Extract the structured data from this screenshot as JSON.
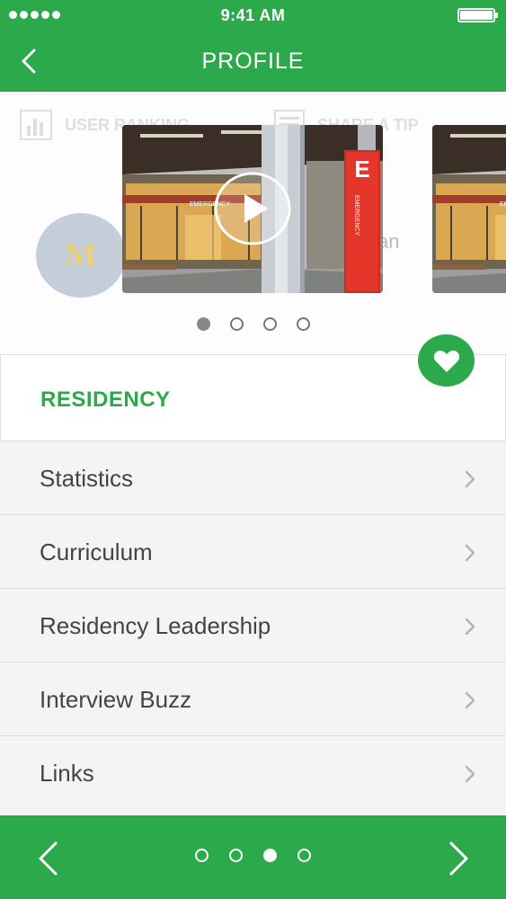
{
  "status_bar": {
    "time": "9:41 AM"
  },
  "nav": {
    "title": "PROFILE",
    "back_icon": "chevron-left-icon"
  },
  "header": {
    "faded_tabs": [
      {
        "label": "USER RANKING",
        "icon": "bar-chart-icon"
      },
      {
        "label": "SHARE A TIP",
        "icon": "document-icon"
      }
    ],
    "logo_letter": "M",
    "ghost_text": "an",
    "carousel": {
      "page_count": 4,
      "active_page": 1
    }
  },
  "section": {
    "title": "RESIDENCY",
    "favorite_icon": "heart-icon"
  },
  "menu": [
    {
      "label": "Statistics"
    },
    {
      "label": "Curriculum"
    },
    {
      "label": "Residency Leadership"
    },
    {
      "label": "Interview Buzz"
    },
    {
      "label": "Links"
    }
  ],
  "bottom_bar": {
    "page_count": 4,
    "active_page": 3
  },
  "colors": {
    "brand_green": "#2ca94b",
    "text_dark": "#444444",
    "logo_gold": "#e3c75a",
    "logo_bg": "#b7c3d3"
  }
}
